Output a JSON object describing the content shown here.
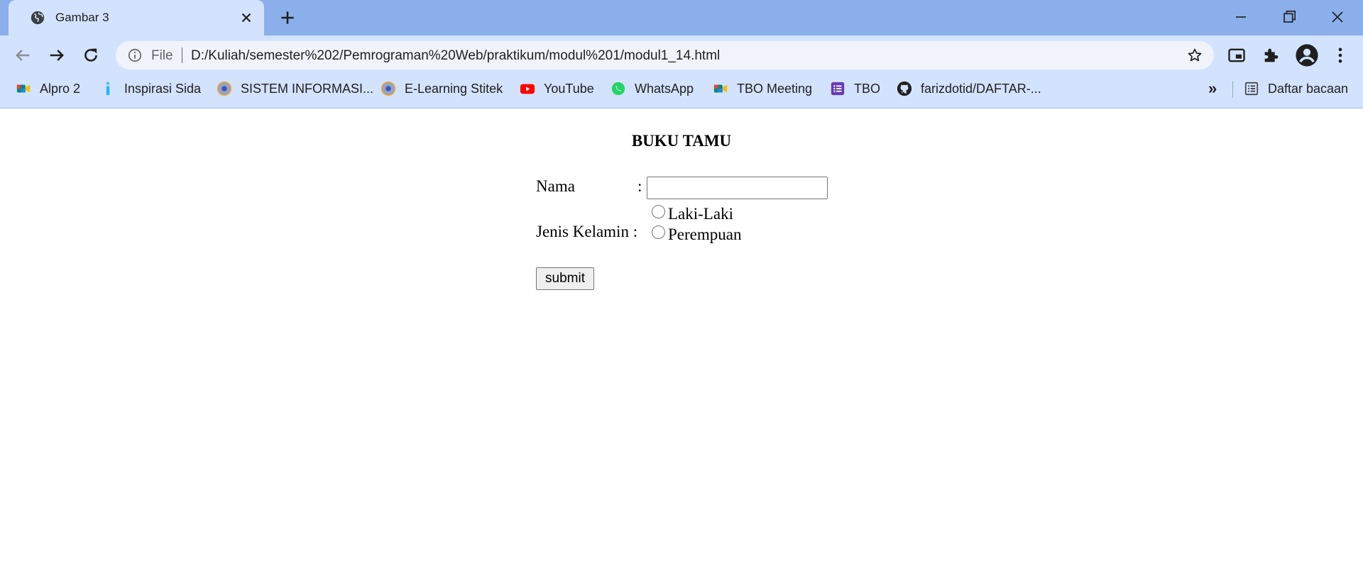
{
  "browser": {
    "tab": {
      "title": "Gambar 3",
      "icon": "globe-icon"
    },
    "omnibox": {
      "scheme_label": "File",
      "url": "D:/Kuliah/semester%202/Pemrograman%20Web/praktikum/modul%201/modul1_14.html"
    },
    "bookmarks": [
      {
        "label": "Alpro 2",
        "icon": "google-meet-icon"
      },
      {
        "label": "Inspirasi Sida",
        "icon": "info-pin-icon"
      },
      {
        "label": "SISTEM INFORMASI...",
        "icon": "stitek-logo-icon"
      },
      {
        "label": "E-Learning Stitek",
        "icon": "stitek-logo-icon"
      },
      {
        "label": "YouTube",
        "icon": "youtube-icon"
      },
      {
        "label": "WhatsApp",
        "icon": "whatsapp-icon"
      },
      {
        "label": "TBO Meeting",
        "icon": "google-meet-icon"
      },
      {
        "label": "TBO",
        "icon": "google-forms-icon"
      },
      {
        "label": "farizdotid/DAFTAR-...",
        "icon": "github-icon"
      }
    ],
    "bookmarks_overflow": "»",
    "reading_list": {
      "label": "Daftar bacaan",
      "icon": "reading-list-icon"
    }
  },
  "page": {
    "title": "BUKU TAMU",
    "form": {
      "nama_label": "Nama",
      "nama_colon": ":",
      "nama_value": "",
      "gender_label": "Jenis Kelamin :",
      "gender_options": [
        "Laki-Laki",
        "Perempuan"
      ],
      "submit_label": "submit"
    }
  },
  "colors": {
    "tabstrip_bg": "#8aafea",
    "toolbar_bg": "#d3e3fd",
    "omnibox_bg": "#f0f4fa"
  }
}
